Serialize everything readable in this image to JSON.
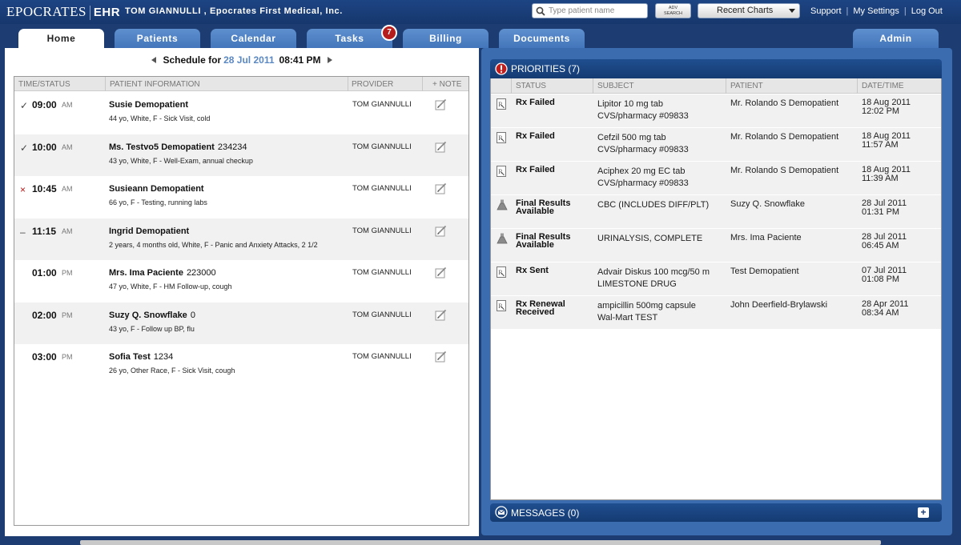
{
  "topbar": {
    "brand": "EPOCRATES",
    "product": "EHR",
    "user_line": "TOM GIANNULLI , Epocrates First Medical, Inc.",
    "search_placeholder": "Type patient name",
    "adv_search_label": "ADV\nSEARCH",
    "recent_charts_label": "Recent Charts",
    "links": [
      "Support",
      "My Settings",
      "Log Out"
    ]
  },
  "tabs": [
    {
      "label": "Home",
      "active": true
    },
    {
      "label": "Patients"
    },
    {
      "label": "Calendar"
    },
    {
      "label": "Tasks",
      "badge": "7"
    },
    {
      "label": "Billing"
    },
    {
      "label": "Documents"
    },
    {
      "label": "Admin"
    }
  ],
  "schedule": {
    "label": "Schedule for",
    "date": "28 Jul 2011",
    "time": "08:41 PM",
    "columns": [
      "TIME/STATUS",
      "PATIENT INFORMATION",
      "PROVIDER",
      "+ NOTE"
    ],
    "rows": [
      {
        "status": "✓",
        "time": "09:00",
        "ampm": "AM",
        "name": "Susie Demopatient",
        "id": "",
        "details": "44 yo, White, F - Sick Visit, cold",
        "provider": "TOM GIANNULLI"
      },
      {
        "status": "✓",
        "time": "10:00",
        "ampm": "AM",
        "name": "Ms. Testvo5 Demopatient",
        "id": "234234",
        "details": "43 yo, White, F - Well-Exam, annual checkup",
        "provider": "TOM GIANNULLI"
      },
      {
        "status": "×",
        "time": "10:45",
        "ampm": "AM",
        "name": "Susieann Demopatient",
        "id": "",
        "details": "66 yo, F - Testing, running labs",
        "provider": "TOM GIANNULLI"
      },
      {
        "status": "–",
        "time": "11:15",
        "ampm": "AM",
        "name": "Ingrid Demopatient",
        "id": "",
        "details": "2 years, 4 months old, White, F - Panic and Anxiety Attacks, 2 1/2",
        "provider": "TOM GIANNULLI"
      },
      {
        "status": "",
        "time": "01:00",
        "ampm": "PM",
        "name": "Mrs. Ima Paciente",
        "id": "223000",
        "details": "47 yo, White, F - HM Follow-up, cough",
        "provider": "TOM GIANNULLI"
      },
      {
        "status": "",
        "time": "02:00",
        "ampm": "PM",
        "name": "Suzy Q. Snowflake",
        "id": "0",
        "details": "43 yo, F - Follow up BP, flu",
        "provider": "TOM GIANNULLI"
      },
      {
        "status": "",
        "time": "03:00",
        "ampm": "PM",
        "name": "Sofia Test",
        "id": "1234",
        "details": "26 yo, Other Race, F - Sick Visit, cough",
        "provider": "TOM GIANNULLI"
      }
    ]
  },
  "priorities": {
    "title": "PRIORITIES (7)",
    "columns": [
      "STATUS",
      "SUBJECT",
      "PATIENT",
      "DATE/TIME"
    ],
    "rows": [
      {
        "icon": "rx-icon",
        "status": "Rx Failed",
        "subject1": "Lipitor 10 mg tab",
        "subject2": "CVS/pharmacy #09833",
        "patient": "Mr. Rolando S Demopatient",
        "date": "18 Aug 2011",
        "time": "12:02 PM"
      },
      {
        "icon": "rx-icon",
        "status": "Rx Failed",
        "subject1": "Cefzil 500 mg tab",
        "subject2": "CVS/pharmacy #09833",
        "patient": "Mr. Rolando S Demopatient",
        "date": "18 Aug 2011",
        "time": "11:57 AM"
      },
      {
        "icon": "rx-icon",
        "status": "Rx Failed",
        "subject1": "Aciphex 20 mg EC tab",
        "subject2": "CVS/pharmacy #09833",
        "patient": "Mr. Rolando S Demopatient",
        "date": "18 Aug 2011",
        "time": "11:39 AM"
      },
      {
        "icon": "lab-flask-icon",
        "status": "Final Results Available",
        "subject1": "CBC (INCLUDES DIFF/PLT)",
        "subject2": "",
        "patient": "Suzy Q. Snowflake",
        "date": "28 Jul 2011",
        "time": "01:31 PM"
      },
      {
        "icon": "lab-flask-icon",
        "status": "Final Results Available",
        "subject1": "URINALYSIS, COMPLETE",
        "subject2": "",
        "patient": "Mrs. Ima Paciente",
        "date": "28 Jul 2011",
        "time": "06:45 AM"
      },
      {
        "icon": "rx-icon",
        "status": "Rx Sent",
        "subject1": "Advair Diskus 100 mcg/50 m",
        "subject2": "LIMESTONE DRUG",
        "patient": "Test Demopatient",
        "date": "07 Jul 2011",
        "time": "01:08 PM"
      },
      {
        "icon": "rx-icon",
        "status": "Rx Renewal Received",
        "subject1": "ampicillin 500mg capsule",
        "subject2": "Wal-Mart TEST",
        "patient": "John Deerfield-Brylawski",
        "date": "28 Apr 2011",
        "time": "08:34 AM"
      }
    ]
  },
  "messages": {
    "title": "MESSAGES (0)",
    "add_label": "+"
  }
}
